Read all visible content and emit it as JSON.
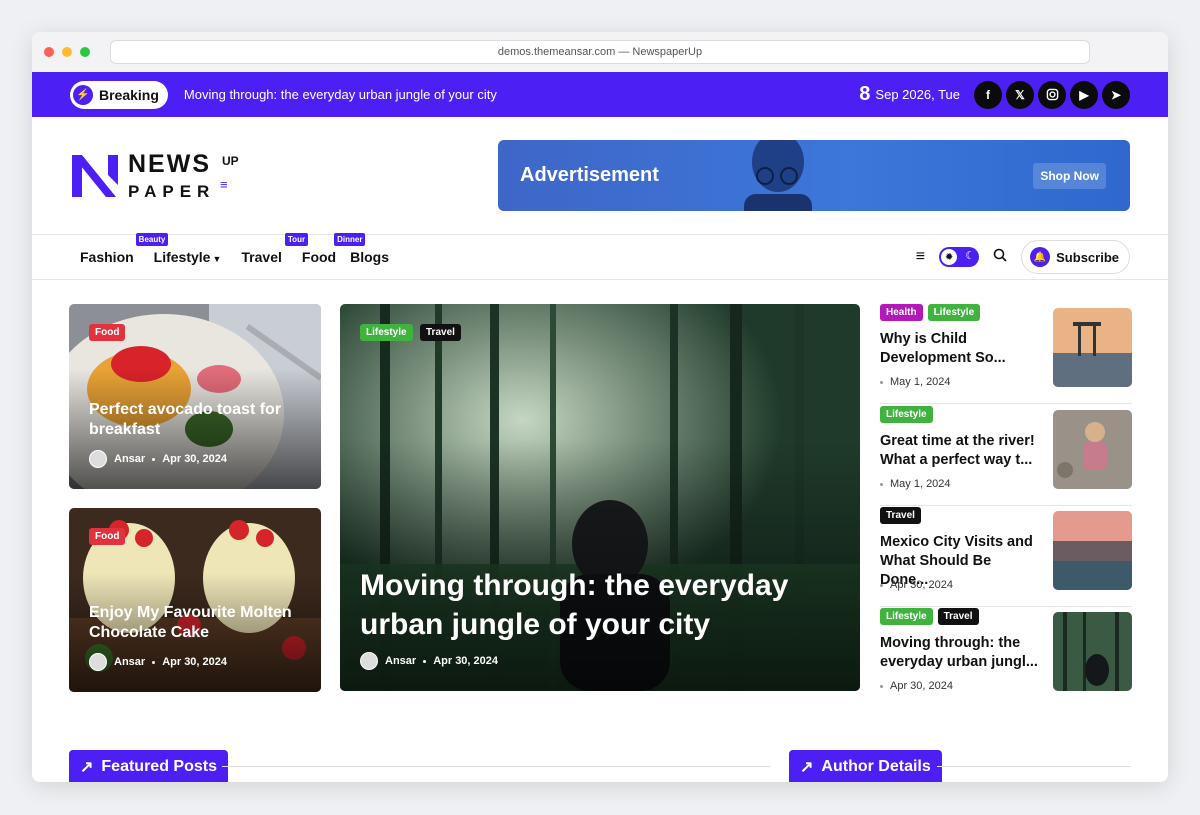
{
  "browser": {
    "url": "demos.themeansar.com — NewspaperUp"
  },
  "topbar": {
    "breaking_label": "Breaking",
    "breaking_text": "Moving through: the everyday urban jungle of your city",
    "date_day": "8",
    "date_rest": "Sep 2026, Tue",
    "socials": [
      "facebook-icon",
      "x-icon",
      "instagram-icon",
      "youtube-icon",
      "telegram-icon"
    ],
    "accent": "#4c1ff5"
  },
  "logo": {
    "word1": "NEWS",
    "word2": "PAPER",
    "up": "UP"
  },
  "ad": {
    "title": "Advertisement",
    "button": "Shop Now"
  },
  "nav": {
    "items": [
      {
        "label": "Fashion",
        "tag": ""
      },
      {
        "label": "Lifestyle",
        "tag": "Beauty"
      },
      {
        "label": "Travel",
        "tag": ""
      },
      {
        "label": "Food",
        "tag": "Tour"
      },
      {
        "label": "Blogs",
        "tag": "Dinner"
      }
    ],
    "subscribe": "Subscribe"
  },
  "cards": {
    "left1": {
      "category": "Food",
      "title": "Perfect avocado toast for breakfast",
      "author": "Ansar",
      "date": "Apr 30, 2024"
    },
    "left2": {
      "category": "Food",
      "title": "Enjoy My Favourite Molten Chocolate Cake",
      "author": "Ansar",
      "date": "Apr 30, 2024"
    },
    "hero": {
      "categories": [
        "Lifestyle",
        "Travel"
      ],
      "title": "Moving through: the everyday urban jungle of your city",
      "author": "Ansar",
      "date": "Apr 30, 2024"
    }
  },
  "side": [
    {
      "tags": [
        "Health",
        "Lifestyle"
      ],
      "title": "Why is Child Development So...",
      "date": "May 1, 2024"
    },
    {
      "tags": [
        "Lifestyle"
      ],
      "title": "Great time at the river! What a perfect way t...",
      "date": "May 1, 2024"
    },
    {
      "tags": [
        "Travel"
      ],
      "title": "Mexico City Visits and What Should Be Done...",
      "date": "Apr 30, 2024"
    },
    {
      "tags": [
        "Lifestyle",
        "Travel"
      ],
      "title": "Moving through: the everyday urban jungl...",
      "date": "Apr 30, 2024"
    }
  ],
  "sections": {
    "featured": "Featured Posts",
    "author": "Author Details"
  }
}
